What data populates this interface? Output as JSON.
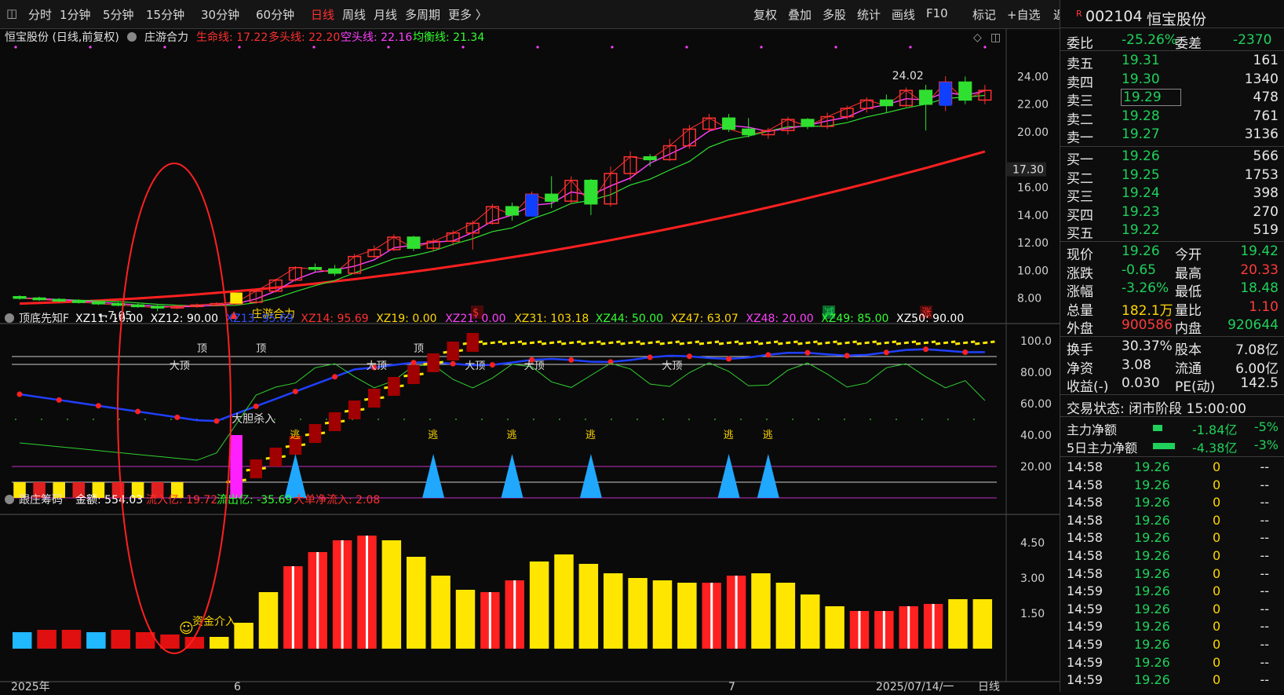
{
  "toolbar": {
    "periods": [
      "分时",
      "1分钟",
      "5分钟",
      "15分钟",
      "30分钟",
      "60分钟",
      "日线",
      "周线",
      "月线",
      "多周期",
      "更多 〉"
    ],
    "active_period": "日线",
    "tools": [
      "复权",
      "叠加",
      "多股",
      "统计",
      "画线",
      "F10",
      "标记",
      "+自选",
      "返回"
    ]
  },
  "main_panel": {
    "title": "恒宝股份 (日线,前复权)",
    "indicator_name": "庄游合力",
    "legend": [
      {
        "text": "生命线: 17.22",
        "color": "#ff3030"
      },
      {
        "text": "多头线: 22.20",
        "color": "#ff3030"
      },
      {
        "text": "空头线: 22.16",
        "color": "#ff40ff"
      },
      {
        "text": "均衡线: 21.34",
        "color": "#30ff30"
      }
    ],
    "price_axis": [
      "24.00",
      "22.00",
      "20.00",
      "16.00",
      "14.00",
      "12.00",
      "10.00",
      "8.00"
    ],
    "price_marker": "17.30",
    "high_label": "24.02",
    "low_label": "7.05",
    "signal_label": "庄游合力",
    "bottom_marks": [
      {
        "text": "$",
        "color": "#ff3030"
      },
      {
        "text": "减",
        "color": "#1fd15b"
      },
      {
        "text": "涨",
        "color": "#ff3030"
      }
    ]
  },
  "mid_panel": {
    "name": "顶底先知F",
    "legend": [
      {
        "text": "XZ11: 10.00",
        "color": "#ffffff"
      },
      {
        "text": "XZ12: 90.00",
        "color": "#ffffff"
      },
      {
        "text": "XZ13: 95.69",
        "color": "#3050ff"
      },
      {
        "text": "XZ14: 95.69",
        "color": "#ff3030"
      },
      {
        "text": "XZ19: 0.00",
        "color": "#ffd700"
      },
      {
        "text": "XZ21: 0.00",
        "color": "#ff40ff"
      },
      {
        "text": "XZ31: 103.18",
        "color": "#ffd700"
      },
      {
        "text": "XZ44: 50.00",
        "color": "#30ff30"
      },
      {
        "text": "XZ47: 63.07",
        "color": "#ffd700"
      },
      {
        "text": "XZ48: 20.00",
        "color": "#ff40ff"
      },
      {
        "text": "XZ49: 85.00",
        "color": "#30ff30"
      },
      {
        "text": "XZ50: 90.00",
        "color": "#ffffff"
      }
    ],
    "axis": [
      "100.0",
      "80.00",
      "60.00",
      "40.00",
      "20.00"
    ],
    "top_label": "顶",
    "big_top_label": "大顶",
    "buy_label": "大胆杀入",
    "escape_label": "逃"
  },
  "bottom_panel": {
    "name": "跟庄筹码",
    "legend": [
      {
        "text": "金额: 554.03",
        "color": "#ffffff"
      },
      {
        "text": "流入亿: 19.72",
        "color": "#ff3030"
      },
      {
        "text": "流出亿: -35.69",
        "color": "#30ff30"
      },
      {
        "text": "大单净流入: 2.08",
        "color": "#ff3030"
      }
    ],
    "axis": [
      "4.50",
      "3.00",
      "1.50"
    ],
    "signal_label": "资金介入"
  },
  "x_axis": {
    "labels": [
      "2025年",
      "6",
      "7",
      "2025/07/14/一",
      "日线"
    ]
  },
  "sidebar": {
    "code": "002104",
    "name": "恒宝股份",
    "ratio": {
      "label1": "委比",
      "value1": "-25.26%",
      "label2": "委差",
      "value2": "-2370"
    },
    "asks": [
      {
        "label": "卖五",
        "price": "19.31",
        "vol": "161"
      },
      {
        "label": "卖四",
        "price": "19.30",
        "vol": "1340"
      },
      {
        "label": "卖三",
        "price": "19.29",
        "vol": "478"
      },
      {
        "label": "卖二",
        "price": "19.28",
        "vol": "761"
      },
      {
        "label": "卖一",
        "price": "19.27",
        "vol": "3136"
      }
    ],
    "bids": [
      {
        "label": "买一",
        "price": "19.26",
        "vol": "566"
      },
      {
        "label": "买二",
        "price": "19.25",
        "vol": "1753"
      },
      {
        "label": "买三",
        "price": "19.24",
        "vol": "398"
      },
      {
        "label": "买四",
        "price": "19.23",
        "vol": "270"
      },
      {
        "label": "买五",
        "price": "19.22",
        "vol": "519"
      }
    ],
    "stats": [
      {
        "l1": "现价",
        "v1": "19.26",
        "c1": "green",
        "l2": "今开",
        "v2": "19.42",
        "c2": "green"
      },
      {
        "l1": "涨跌",
        "v1": "-0.65",
        "c1": "green",
        "l2": "最高",
        "v2": "20.33",
        "c2": "red"
      },
      {
        "l1": "涨幅",
        "v1": "-3.26%",
        "c1": "green",
        "l2": "最低",
        "v2": "18.48",
        "c2": "green"
      },
      {
        "l1": "总量",
        "v1": "182.1万",
        "c1": "yellow",
        "l2": "量比",
        "v2": "1.10",
        "c2": "red"
      },
      {
        "l1": "外盘",
        "v1": "900586",
        "c1": "red",
        "l2": "内盘",
        "v2": "920644",
        "c2": "green"
      }
    ],
    "stats2": [
      {
        "l1": "换手",
        "v1": "30.37%",
        "l2": "股本",
        "v2": "7.08亿"
      },
      {
        "l1": "净资",
        "v1": "3.08",
        "l2": "流通",
        "v2": "6.00亿"
      },
      {
        "l1": "收益(-)",
        "v1": "0.030",
        "l2": "PE(动)",
        "v2": "142.5"
      }
    ],
    "trade_status": "交易状态: 闭市阶段 15:00:00",
    "flows": [
      {
        "label": "主力净额",
        "value": "-1.84亿",
        "pct": "-5%"
      },
      {
        "label": "5日主力净额",
        "value": "-4.38亿",
        "pct": "-3%"
      }
    ],
    "ticks": [
      {
        "time": "14:58",
        "price": "19.26",
        "vol": "0",
        "flag": "--"
      },
      {
        "time": "14:58",
        "price": "19.26",
        "vol": "0",
        "flag": "--"
      },
      {
        "time": "14:58",
        "price": "19.26",
        "vol": "0",
        "flag": "--"
      },
      {
        "time": "14:58",
        "price": "19.26",
        "vol": "0",
        "flag": "--"
      },
      {
        "time": "14:58",
        "price": "19.26",
        "vol": "0",
        "flag": "--"
      },
      {
        "time": "14:58",
        "price": "19.26",
        "vol": "0",
        "flag": "--"
      },
      {
        "time": "14:58",
        "price": "19.26",
        "vol": "0",
        "flag": "--"
      },
      {
        "time": "14:59",
        "price": "19.26",
        "vol": "0",
        "flag": "--"
      },
      {
        "time": "14:59",
        "price": "19.26",
        "vol": "0",
        "flag": "--"
      },
      {
        "time": "14:59",
        "price": "19.26",
        "vol": "0",
        "flag": "--"
      },
      {
        "time": "14:59",
        "price": "19.26",
        "vol": "0",
        "flag": "--"
      },
      {
        "time": "14:59",
        "price": "19.26",
        "vol": "0",
        "flag": "--"
      },
      {
        "time": "14:59",
        "price": "19.26",
        "vol": "0",
        "flag": "--"
      }
    ]
  },
  "chart_data": {
    "type": "candlestick",
    "price_range": [
      6.5,
      25.5
    ],
    "candles": [
      [
        8.1,
        8.0,
        8.2,
        7.9
      ],
      [
        8.0,
        7.9,
        8.1,
        7.8
      ],
      [
        7.9,
        7.8,
        8.0,
        7.7
      ],
      [
        7.8,
        7.7,
        7.9,
        7.6
      ],
      [
        7.7,
        7.6,
        7.8,
        7.5
      ],
      [
        7.6,
        7.5,
        7.7,
        7.4
      ],
      [
        7.5,
        7.4,
        7.6,
        7.3
      ],
      [
        7.4,
        7.3,
        7.5,
        7.05
      ],
      [
        7.3,
        7.4,
        7.5,
        7.2
      ],
      [
        7.4,
        7.5,
        7.6,
        7.3
      ],
      [
        7.5,
        7.6,
        7.7,
        7.4
      ],
      [
        7.6,
        7.7,
        7.8,
        7.5
      ],
      [
        7.7,
        8.5,
        8.6,
        7.6
      ],
      [
        8.5,
        9.3,
        9.4,
        8.4
      ],
      [
        9.3,
        10.2,
        10.3,
        9.2
      ],
      [
        10.2,
        10.1,
        10.5,
        9.9
      ],
      [
        10.1,
        9.8,
        10.4,
        9.6
      ],
      [
        9.8,
        11.0,
        11.2,
        9.7
      ],
      [
        11.0,
        11.5,
        11.8,
        10.9
      ],
      [
        11.5,
        12.4,
        12.6,
        11.4
      ],
      [
        12.4,
        11.6,
        12.5,
        11.4
      ],
      [
        11.6,
        12.1,
        12.3,
        11.4
      ],
      [
        12.1,
        12.7,
        12.9,
        11.8
      ],
      [
        12.7,
        13.4,
        13.6,
        11.5
      ],
      [
        13.4,
        14.6,
        14.8,
        13.3
      ],
      [
        14.6,
        14.0,
        14.9,
        13.6
      ],
      [
        14.0,
        15.5,
        15.7,
        13.9
      ],
      [
        15.5,
        15.0,
        16.8,
        14.5
      ],
      [
        15.0,
        16.5,
        16.8,
        14.8
      ],
      [
        16.5,
        14.8,
        16.6,
        14.0
      ],
      [
        14.8,
        17.0,
        17.5,
        14.6
      ],
      [
        17.0,
        18.2,
        18.6,
        16.5
      ],
      [
        18.2,
        18.0,
        18.4,
        17.5
      ],
      [
        18.0,
        19.0,
        19.5,
        17.9
      ],
      [
        19.0,
        20.2,
        20.5,
        18.8
      ],
      [
        20.2,
        21.0,
        21.3,
        20.0
      ],
      [
        21.0,
        20.2,
        21.3,
        20.0
      ],
      [
        20.2,
        19.8,
        21.0,
        19.6
      ],
      [
        19.8,
        20.1,
        20.3,
        19.5
      ],
      [
        20.1,
        20.9,
        21.1,
        19.8
      ],
      [
        20.9,
        20.4,
        21.0,
        20.2
      ],
      [
        20.4,
        21.1,
        21.4,
        20.2
      ],
      [
        21.1,
        21.7,
        21.9,
        20.9
      ],
      [
        21.7,
        22.3,
        22.5,
        21.4
      ],
      [
        22.3,
        21.9,
        22.7,
        21.4
      ],
      [
        21.9,
        23.0,
        23.2,
        21.8
      ],
      [
        23.0,
        22.0,
        23.4,
        20.1
      ],
      [
        22.0,
        23.6,
        24.02,
        21.5
      ],
      [
        23.6,
        22.3,
        24.0,
        22.0
      ],
      [
        22.3,
        23.0,
        23.4,
        22.0
      ]
    ],
    "volume_values": [
      0.7,
      0.8,
      0.8,
      0.7,
      0.8,
      0.7,
      0.6,
      0.5,
      0.5,
      1.1,
      2.4,
      3.5,
      4.1,
      4.6,
      4.8,
      4.6,
      3.9,
      3.1,
      2.5,
      2.4,
      2.9,
      3.7,
      4.0,
      3.6,
      3.2,
      3.0,
      2.9,
      2.8,
      2.8,
      3.1,
      3.2,
      2.8,
      2.3,
      1.8,
      1.6,
      1.6,
      1.8,
      1.9,
      2.1,
      2.1
    ]
  }
}
